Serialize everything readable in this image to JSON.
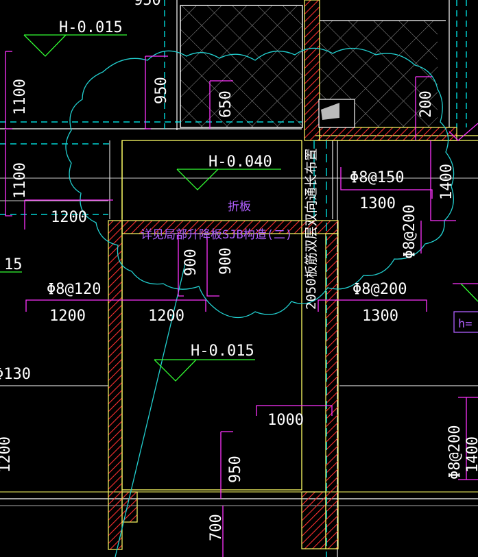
{
  "colors": {
    "background": "#000000",
    "wall_hatch": "#ff3030",
    "wall_outline": "#ffff66",
    "dimension": "#ff33ff",
    "cloud": "#22d0d0",
    "cyan_dash": "#00ffff",
    "level_mark": "#33ff33",
    "note_text": "#b060ff",
    "text": "#ffffff"
  },
  "levels": {
    "top_left": "H-0.015",
    "center": "H-0.040",
    "bottom": "H-0.015"
  },
  "notes": {
    "fold_plate": "折板",
    "reference": "详见局部升降板SJB构造(二)",
    "rebar_note": "2050板筋双层双向通长布置",
    "right_box": "h="
  },
  "dimensions": {
    "top_cut": "950",
    "left_1100_a": "1100",
    "left_1100_b": "1100",
    "v_950_top": "950",
    "v_650": "650",
    "left_1200": "1200",
    "v_900_a": "900",
    "v_900_b": "900",
    "left_15": "15",
    "rebar_left": "Φ8@120",
    "span_1200_a": "1200",
    "span_1200_b": "1200",
    "rebar_130": "Φ130",
    "left_200_cut": "1200",
    "rebar_top_right": "Φ8@150",
    "span_1300_top": "1300",
    "v_200": "200",
    "v_1400": "1400",
    "v_phi8_200": "Φ8@200",
    "rebar_right": "Φ8@200",
    "span_1300": "1300",
    "span_1000": "1000",
    "v_950_bottom": "950",
    "v_700": "700",
    "right_phi8_200": "Φ8@200",
    "right_1400_cut": "1400"
  }
}
